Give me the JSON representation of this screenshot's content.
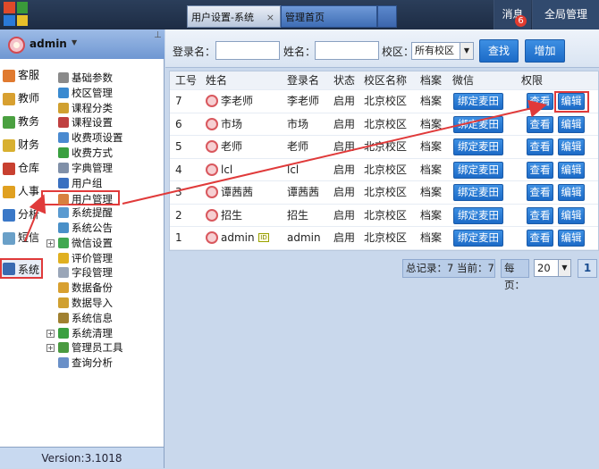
{
  "tabs": [
    {
      "label": "用户设置-系统",
      "close": "×"
    },
    {
      "label": "管理首页"
    }
  ],
  "topbar": {
    "messages_label": "消息",
    "messages_count": "6",
    "global_admin_label": "全局管理"
  },
  "user": {
    "name": "admin"
  },
  "modules": [
    {
      "label": "客服",
      "color": "#e07a30"
    },
    {
      "label": "教师",
      "color": "#d8a030"
    },
    {
      "label": "教务",
      "color": "#4aa040"
    },
    {
      "label": "财务",
      "color": "#d8b030"
    },
    {
      "label": "仓库",
      "color": "#c84030"
    },
    {
      "label": "人事",
      "color": "#e0a020"
    },
    {
      "label": "分析",
      "color": "#3a78c8"
    },
    {
      "label": "短信",
      "color": "#6aa0c8"
    },
    {
      "label": "系统",
      "color": "#3a6ab0"
    }
  ],
  "tree": [
    {
      "label": "基础参数",
      "color": "#8a8a8a",
      "expander": ""
    },
    {
      "label": "校区管理",
      "color": "#3a8ad0",
      "expander": ""
    },
    {
      "label": "课程分类",
      "color": "#d0a030",
      "expander": ""
    },
    {
      "label": "课程设置",
      "color": "#c04040",
      "expander": ""
    },
    {
      "label": "收费项设置",
      "color": "#4a8ad0",
      "expander": ""
    },
    {
      "label": "收费方式",
      "color": "#3aa040",
      "expander": ""
    },
    {
      "label": "字典管理",
      "color": "#8090a8",
      "expander": ""
    },
    {
      "label": "用户组",
      "color": "#3a70c0",
      "expander": ""
    },
    {
      "label": "用户管理",
      "color": "#d88040",
      "expander": ""
    },
    {
      "label": "系统提醒",
      "color": "#5a9ad0",
      "expander": ""
    },
    {
      "label": "系统公告",
      "color": "#4a90c8",
      "expander": ""
    },
    {
      "label": "微信设置",
      "color": "#40a850",
      "expander": "+"
    },
    {
      "label": "评价管理",
      "color": "#e0b020",
      "expander": ""
    },
    {
      "label": "字段管理",
      "color": "#9aa6b8",
      "expander": ""
    },
    {
      "label": "数据备份",
      "color": "#d8a030",
      "expander": ""
    },
    {
      "label": "数据导入",
      "color": "#d0a030",
      "expander": ""
    },
    {
      "label": "系统信息",
      "color": "#a08030",
      "expander": ""
    },
    {
      "label": "系统清理",
      "color": "#3aa040",
      "expander": "+"
    },
    {
      "label": "管理员工具",
      "color": "#4a9a40",
      "expander": "+"
    },
    {
      "label": "查询分析",
      "color": "#6a90c8",
      "expander": ""
    }
  ],
  "version": "Version:3.1018",
  "search": {
    "login_label": "登录名：",
    "name_label": "姓名：",
    "campus_label": "校区：",
    "campus_value": "所有校区",
    "search_button": "查找",
    "add_button": "增加"
  },
  "table": {
    "headers": [
      "工号",
      "姓名",
      "登录名",
      "状态",
      "校区名称",
      "档案",
      "微信",
      "权限"
    ],
    "bind_label": "绑定麦田",
    "view_label": "查看",
    "edit_label": "编辑",
    "rows": [
      {
        "id": "7",
        "name": "李老师",
        "login": "李老师",
        "status": "启用",
        "campus": "北京校区",
        "archive": "档案"
      },
      {
        "id": "6",
        "name": "市场",
        "login": "市场",
        "status": "启用",
        "campus": "北京校区",
        "archive": "档案"
      },
      {
        "id": "5",
        "name": "老师",
        "login": "老师",
        "status": "启用",
        "campus": "北京校区",
        "archive": "档案"
      },
      {
        "id": "4",
        "name": "lcl",
        "login": "lcl",
        "status": "启用",
        "campus": "北京校区",
        "archive": "档案"
      },
      {
        "id": "3",
        "name": "谭茜茜",
        "login": "谭茜茜",
        "status": "启用",
        "campus": "北京校区",
        "archive": "档案"
      },
      {
        "id": "2",
        "name": "招生",
        "login": "招生",
        "status": "启用",
        "campus": "北京校区",
        "archive": "档案"
      },
      {
        "id": "1",
        "name": "admin",
        "login": "admin",
        "status": "启用",
        "campus": "北京校区",
        "archive": "档案",
        "badge": "ID"
      }
    ]
  },
  "pager": {
    "summary": "总记录：7 当前：7",
    "page_size_label": "每页：",
    "page_size": "20",
    "current_page": "1"
  },
  "colors": {
    "annotation": "#e03a3a",
    "button": "#1c6bc7"
  }
}
